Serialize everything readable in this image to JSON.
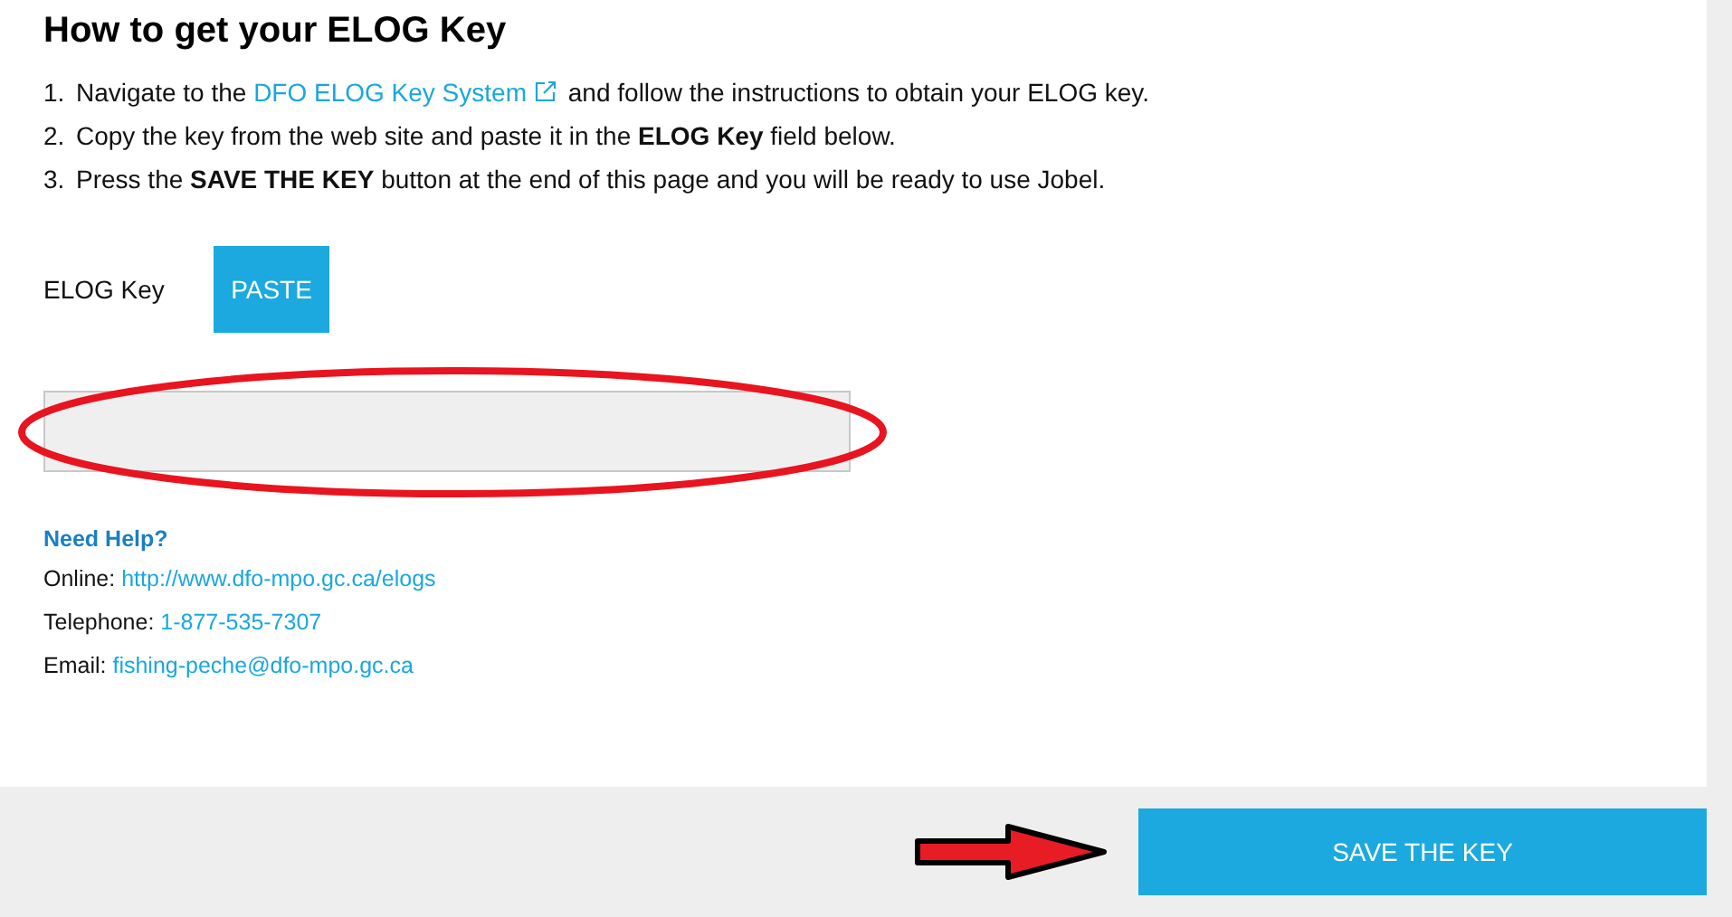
{
  "title": "How to get your ELOG Key",
  "steps": [
    {
      "number": "1.",
      "parts": [
        {
          "kind": "text",
          "text": "Navigate to the "
        },
        {
          "kind": "link",
          "text": "DFO ELOG Key System"
        },
        {
          "kind": "text",
          "text": " and follow the instructions to obtain your ELOG key."
        }
      ]
    },
    {
      "number": "2.",
      "parts": [
        {
          "kind": "text",
          "text": "Copy the key from the web site and paste it in the **ELOG Key** field below."
        }
      ]
    },
    {
      "number": "3.",
      "parts": [
        {
          "kind": "text",
          "text": "Press the **SAVE THE KEY** button at the end of this page and you will be ready to use Jobel."
        }
      ]
    }
  ],
  "key_field": {
    "label": "ELOG Key",
    "paste_button": "PASTE"
  },
  "help": {
    "heading": "Need Help?",
    "rows": [
      {
        "label": "Online:",
        "value": "http://www.dfo-mpo.gc.ca/elogs"
      },
      {
        "label": "Telephone:",
        "value": "1-877-535-7307"
      },
      {
        "label": "Email:",
        "value": "fishing-peche@dfo-mpo.gc.ca"
      }
    ]
  },
  "save_button": "SAVE THE KEY"
}
